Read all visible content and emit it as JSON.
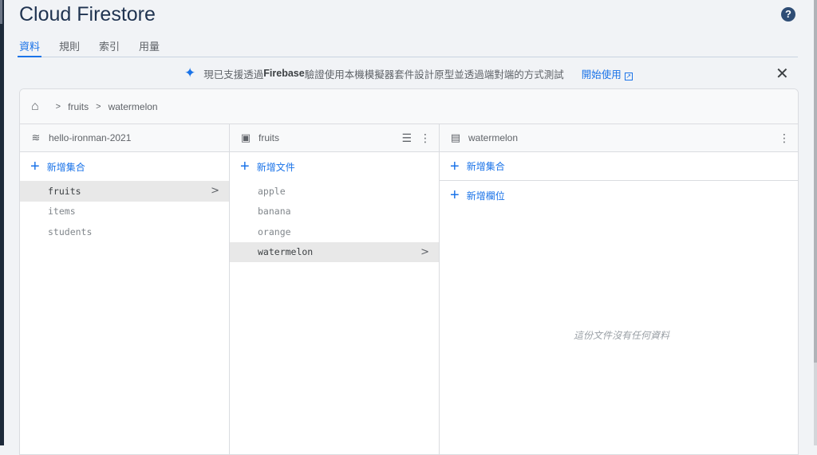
{
  "header": {
    "title": "Cloud Firestore",
    "help_icon": "?"
  },
  "tabs": [
    {
      "label": "資料",
      "active": true
    },
    {
      "label": "規則"
    },
    {
      "label": "索引"
    },
    {
      "label": "用量"
    }
  ],
  "banner": {
    "text_pre": "現已支援透過 ",
    "text_bold": "Firebase",
    "text_post": " 驗證使用本機模擬器套件設計原型並透過端對端的方式測試",
    "link": "開始使用"
  },
  "breadcrumb": [
    "fruits",
    "watermelon"
  ],
  "columns": {
    "project": {
      "title": "hello-ironman-2021",
      "add_label": "新增集合",
      "items": [
        "fruits",
        "items",
        "students"
      ],
      "selected": "fruits"
    },
    "collection": {
      "title": "fruits",
      "add_label": "新增文件",
      "items": [
        "apple",
        "banana",
        "orange",
        "watermelon"
      ],
      "selected": "watermelon"
    },
    "document": {
      "title": "watermelon",
      "add_collection": "新增集合",
      "add_field": "新增欄位",
      "empty_text": "這份文件沒有任何資料"
    }
  },
  "colors": {
    "accent": "#1a73e8",
    "title": "#1f3350"
  }
}
